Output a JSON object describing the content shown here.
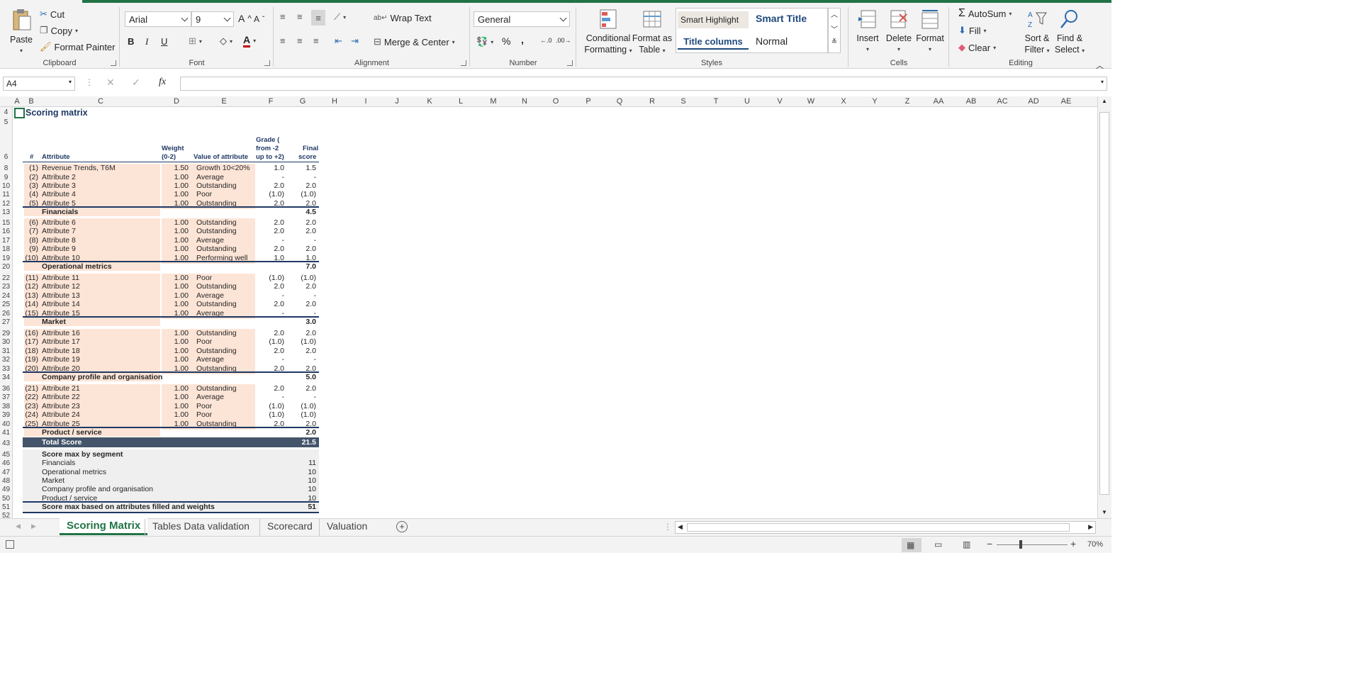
{
  "ribbon": {
    "clipboard": {
      "paste": "Paste",
      "cut": "Cut",
      "copy": "Copy",
      "format_painter": "Format Painter",
      "label": "Clipboard"
    },
    "font": {
      "name": "Arial",
      "size": "9",
      "label": "Font",
      "bold": "B",
      "italic": "I",
      "underline": "U"
    },
    "alignment": {
      "wrap_text": "Wrap Text",
      "merge_center": "Merge & Center",
      "label": "Alignment"
    },
    "number": {
      "format": "General",
      "percent": "%",
      "comma": ",",
      "label": "Number"
    },
    "styles": {
      "conditional_1": "Conditional",
      "conditional_2": "Formatting",
      "format_table_1": "Format as",
      "format_table_2": "Table",
      "smart_highlight": "Smart Highlight",
      "smart_title": "Smart Title",
      "title_columns": "Title columns",
      "normal": "Normal",
      "label": "Styles"
    },
    "cells": {
      "insert": "Insert",
      "delete": "Delete",
      "format": "Format",
      "label": "Cells"
    },
    "editing": {
      "autosum": "AutoSum",
      "fill": "Fill",
      "clear": "Clear",
      "sort_1": "Sort &",
      "sort_2": "Filter",
      "find_1": "Find &",
      "find_2": "Select",
      "label": "Editing"
    }
  },
  "formula_bar": {
    "name_box": "A4",
    "fx": "fx",
    "content": ""
  },
  "columns": [
    "A",
    "B",
    "C",
    "D",
    "E",
    "F",
    "G",
    "H",
    "I",
    "J",
    "K",
    "L",
    "M",
    "N",
    "O",
    "P",
    "Q",
    "R",
    "S",
    "T",
    "U",
    "V",
    "W",
    "X",
    "Y",
    "Z",
    "AA",
    "AB",
    "AC",
    "AD",
    "AE"
  ],
  "rows": [
    "4",
    "5",
    "6",
    "8",
    "9",
    "10",
    "11",
    "12",
    "13",
    "15",
    "16",
    "17",
    "18",
    "19",
    "20",
    "22",
    "23",
    "24",
    "25",
    "26",
    "27",
    "29",
    "30",
    "31",
    "32",
    "33",
    "34",
    "36",
    "37",
    "38",
    "39",
    "40",
    "41",
    "43",
    "45",
    "46",
    "47",
    "48",
    "49",
    "50",
    "51",
    "52"
  ],
  "sheet": {
    "title": "Scoring matrix",
    "headers": {
      "num": "#",
      "attribute": "Attribute",
      "weight_1": "Weight",
      "weight_2": "(0-2)",
      "value": "Value of attribute",
      "grade_1": "Grade (",
      "grade_2": "from -2",
      "grade_3": "up to +2)",
      "final_1": "Final",
      "final_2": "score"
    },
    "groups": [
      {
        "name": "Financials",
        "total": "4.5",
        "items": [
          {
            "n": "(1)",
            "a": "Revenue Trends, T6M",
            "w": "1.50",
            "v": "Growth 10<20%",
            "g": "1.0",
            "f": "1.5"
          },
          {
            "n": "(2)",
            "a": "Attribute 2",
            "w": "1.00",
            "v": "Average",
            "g": "-",
            "f": "-"
          },
          {
            "n": "(3)",
            "a": "Attribute 3",
            "w": "1.00",
            "v": "Outstanding",
            "g": "2.0",
            "f": "2.0"
          },
          {
            "n": "(4)",
            "a": "Attribute 4",
            "w": "1.00",
            "v": "Poor",
            "g": "(1.0)",
            "f": "(1.0)"
          },
          {
            "n": "(5)",
            "a": "Attribute 5",
            "w": "1.00",
            "v": "Outstanding",
            "g": "2.0",
            "f": "2.0"
          }
        ]
      },
      {
        "name": "Operational metrics",
        "total": "7.0",
        "items": [
          {
            "n": "(6)",
            "a": "Attribute 6",
            "w": "1.00",
            "v": "Outstanding",
            "g": "2.0",
            "f": "2.0"
          },
          {
            "n": "(7)",
            "a": "Attribute 7",
            "w": "1.00",
            "v": "Outstanding",
            "g": "2.0",
            "f": "2.0"
          },
          {
            "n": "(8)",
            "a": "Attribute 8",
            "w": "1.00",
            "v": "Average",
            "g": "-",
            "f": "-"
          },
          {
            "n": "(9)",
            "a": "Attribute 9",
            "w": "1.00",
            "v": "Outstanding",
            "g": "2.0",
            "f": "2.0"
          },
          {
            "n": "(10)",
            "a": "Attribute 10",
            "w": "1.00",
            "v": "Performing well",
            "g": "1.0",
            "f": "1.0"
          }
        ]
      },
      {
        "name": "Market",
        "total": "3.0",
        "items": [
          {
            "n": "(11)",
            "a": "Attribute 11",
            "w": "1.00",
            "v": "Poor",
            "g": "(1.0)",
            "f": "(1.0)"
          },
          {
            "n": "(12)",
            "a": "Attribute 12",
            "w": "1.00",
            "v": "Outstanding",
            "g": "2.0",
            "f": "2.0"
          },
          {
            "n": "(13)",
            "a": "Attribute 13",
            "w": "1.00",
            "v": "Average",
            "g": "-",
            "f": "-"
          },
          {
            "n": "(14)",
            "a": "Attribute 14",
            "w": "1.00",
            "v": "Outstanding",
            "g": "2.0",
            "f": "2.0"
          },
          {
            "n": "(15)",
            "a": "Attribute 15",
            "w": "1.00",
            "v": "Average",
            "g": "-",
            "f": "-"
          }
        ]
      },
      {
        "name": "Company profile and organisation",
        "total": "5.0",
        "items": [
          {
            "n": "(16)",
            "a": "Attribute 16",
            "w": "1.00",
            "v": "Outstanding",
            "g": "2.0",
            "f": "2.0"
          },
          {
            "n": "(17)",
            "a": "Attribute 17",
            "w": "1.00",
            "v": "Poor",
            "g": "(1.0)",
            "f": "(1.0)"
          },
          {
            "n": "(18)",
            "a": "Attribute 18",
            "w": "1.00",
            "v": "Outstanding",
            "g": "2.0",
            "f": "2.0"
          },
          {
            "n": "(19)",
            "a": "Attribute 19",
            "w": "1.00",
            "v": "Average",
            "g": "-",
            "f": "-"
          },
          {
            "n": "(20)",
            "a": "Attribute 20",
            "w": "1.00",
            "v": "Outstanding",
            "g": "2.0",
            "f": "2.0"
          }
        ]
      },
      {
        "name": "Product / service",
        "total": "2.0",
        "items": [
          {
            "n": "(21)",
            "a": "Attribute 21",
            "w": "1.00",
            "v": "Outstanding",
            "g": "2.0",
            "f": "2.0"
          },
          {
            "n": "(22)",
            "a": "Attribute 22",
            "w": "1.00",
            "v": "Average",
            "g": "-",
            "f": "-"
          },
          {
            "n": "(23)",
            "a": "Attribute 23",
            "w": "1.00",
            "v": "Poor",
            "g": "(1.0)",
            "f": "(1.0)"
          },
          {
            "n": "(24)",
            "a": "Attribute 24",
            "w": "1.00",
            "v": "Poor",
            "g": "(1.0)",
            "f": "(1.0)"
          },
          {
            "n": "(25)",
            "a": "Attribute 25",
            "w": "1.00",
            "v": "Outstanding",
            "g": "2.0",
            "f": "2.0"
          }
        ]
      }
    ],
    "total_label": "Total Score",
    "total_value": "21.5",
    "max_title": "Score max by segment",
    "max_rows": [
      {
        "label": "Financials",
        "value": "11"
      },
      {
        "label": "Operational metrics",
        "value": "10"
      },
      {
        "label": "Market",
        "value": "10"
      },
      {
        "label": "Company profile and organisation",
        "value": "10"
      },
      {
        "label": "Product / service",
        "value": "10"
      }
    ],
    "max_total_label": "Score max based on attributes filled and weights",
    "max_total_value": "51"
  },
  "tabs": [
    {
      "label": "Scoring Matrix",
      "active": true
    },
    {
      "label": "Tables Data validation",
      "active": false
    },
    {
      "label": "Scorecard",
      "active": false
    },
    {
      "label": "Valuation",
      "active": false
    }
  ],
  "status": {
    "zoom": "70%"
  },
  "colors": {
    "excel_green": "#217346",
    "peach": "#fce4d6",
    "header_blue": "#44546a",
    "title_blue": "#1f3864"
  }
}
